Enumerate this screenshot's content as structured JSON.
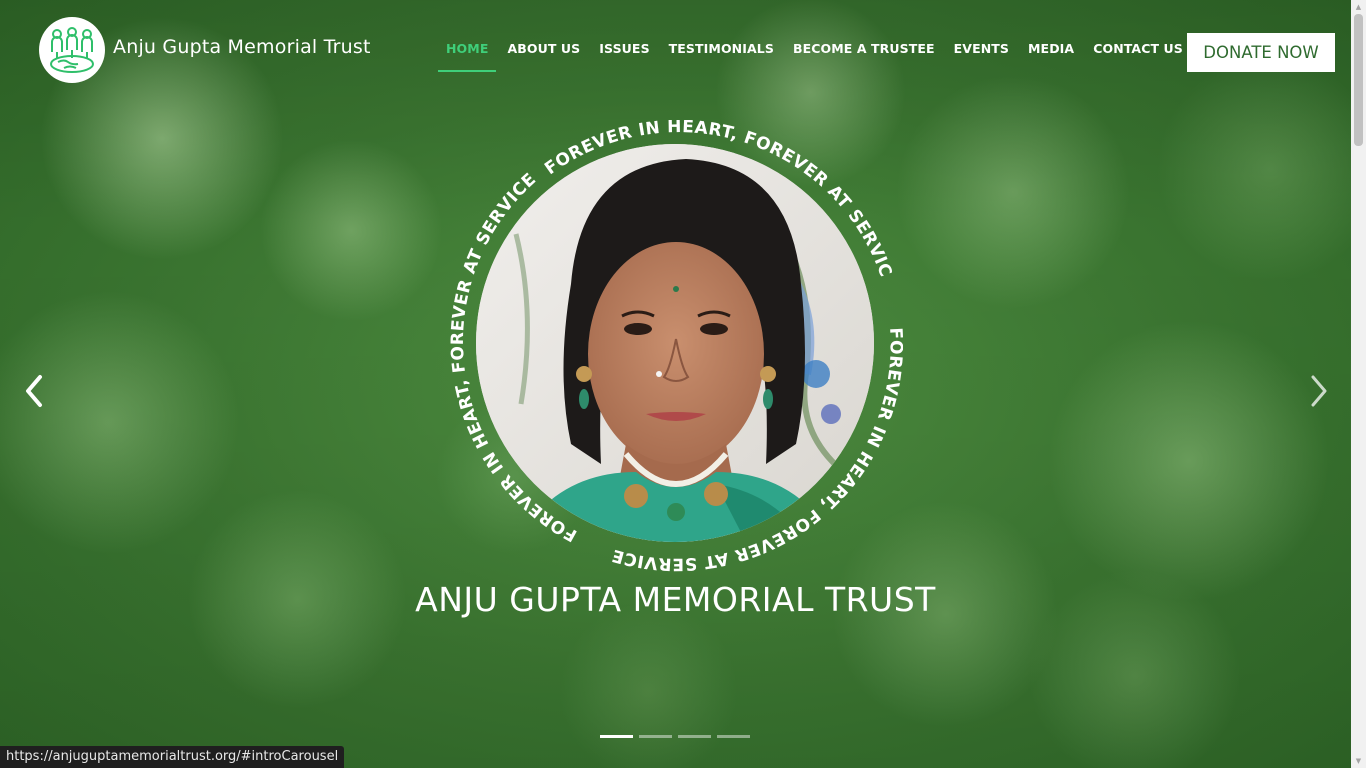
{
  "header": {
    "logo_icon": "people-on-globe-logo",
    "brand_name": "Anju Gupta Memorial Trust"
  },
  "nav": {
    "items": [
      {
        "label": "HOME",
        "active": true
      },
      {
        "label": "ABOUT US",
        "active": false
      },
      {
        "label": "ISSUES",
        "active": false
      },
      {
        "label": "TESTIMONIALS",
        "active": false
      },
      {
        "label": "BECOME A TRUSTEE",
        "active": false
      },
      {
        "label": "EVENTS",
        "active": false
      },
      {
        "label": "MEDIA",
        "active": false
      },
      {
        "label": "CONTACT US",
        "active": false
      }
    ],
    "donate_label": "DONATE NOW"
  },
  "hero": {
    "ring_text_top": "FOREVER IN HEART, FOREVER AT SERVICE",
    "ring_text_left": "FOREVER IN HEART, FOREVER AT SERVICE",
    "ring_text_right": "FOREVER IN HEART, FOREVER AT SERVICE",
    "title": "ANJU GUPTA MEMORIAL TRUST",
    "prev_icon": "chevron-left-icon",
    "next_icon": "chevron-right-icon",
    "slide_count": 4,
    "active_slide": 1
  },
  "status_bar": {
    "url": "https://anjuguptamemorialtrust.org/#introCarousel"
  },
  "colors": {
    "accent": "#3fcf7a",
    "donate_text": "#2f6b2f",
    "background_green": "#3f7a35"
  }
}
